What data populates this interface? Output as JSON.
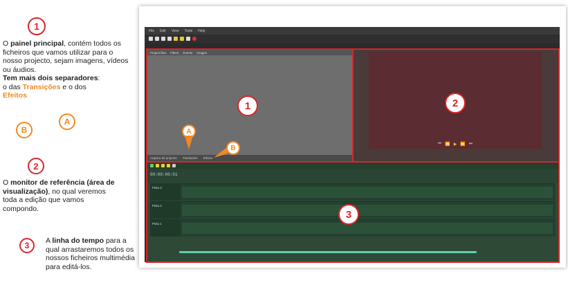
{
  "left_panel": {
    "step1": {
      "number": "1",
      "intro": "O",
      "bold": "painel principal",
      "rest": ", contém todos os ficheiros que vamos utilizar para o nosso projecto, sejam imagens, vídeos ou áudios.",
      "tabs_bold": "Tem mais dois separadores",
      "tabs_colon": ":",
      "tabs_text": "o das",
      "transicoes": "Transições",
      "conj": "e o dos",
      "efeitos": "Efeitos"
    },
    "marker_b": "B",
    "marker_a": "A",
    "step2": {
      "number": "2",
      "intro": "O",
      "bold": "monitor de referência (área de visualização)",
      "rest": ", no qual veremos toda a edição que vamos compondo."
    },
    "step3": {
      "number": "3",
      "intro": "A",
      "bold": "linha do tempo",
      "rest": "para a qual arrastaremos todos os nossos ficheiros multimédia para editá-los."
    }
  },
  "screenshot": {
    "menu": [
      "File",
      "Edit",
      "View",
      "Tools",
      "Help"
    ],
    "p1_tabs": [
      "Project files",
      "Filters",
      "Events",
      "Images"
    ],
    "p1_bottom": [
      "Arquivo de projecto",
      "Transições",
      "Efeitos"
    ],
    "timecode": "00:00:00:01",
    "tracks": [
      "Pista 3",
      "Pista 2",
      "Pista 1"
    ],
    "overlay": {
      "one": "1",
      "two": "2",
      "three": "3",
      "a": "A",
      "b": "B"
    },
    "monitor_controls": [
      "⏮",
      "⏪",
      "▶",
      "⏩",
      "⏭"
    ]
  },
  "colors": {
    "accent_red": "#d8262a",
    "accent_orange": "#f08a24"
  }
}
